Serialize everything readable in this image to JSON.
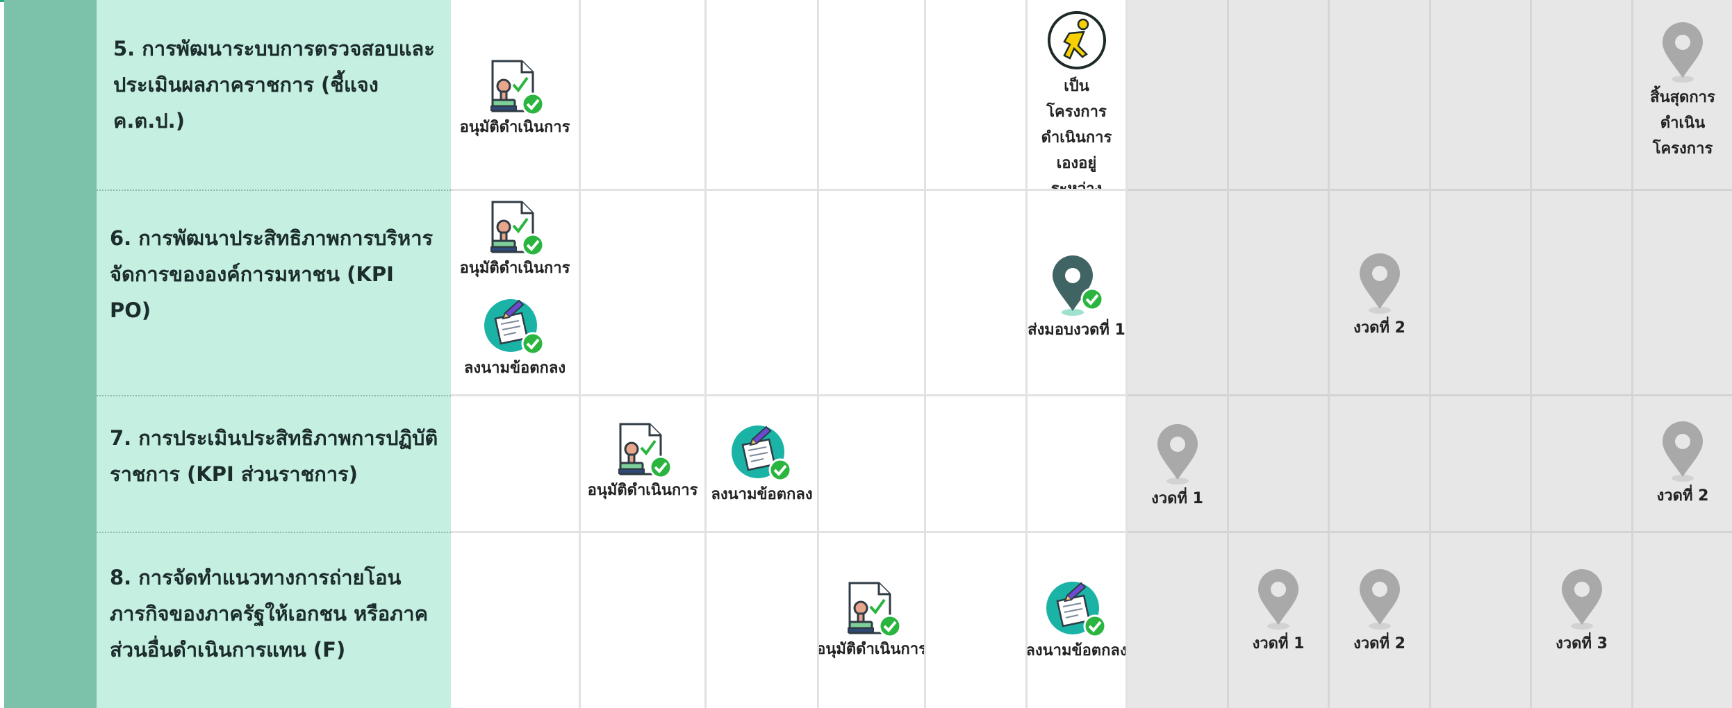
{
  "colors": {
    "accent_line": "#27a98a",
    "left_column": "#7cc2aa",
    "name_cell": "#c4efe1",
    "grey_cell": "#e7e7e7",
    "check_green": "#2ab53f",
    "pin_dark": "#3f6463",
    "pin_grey": "#a9a9a9",
    "sign_teal": "#1ab3a6",
    "aim_yellow": "#f6d000"
  },
  "rows": [
    {
      "name": "5. การพัฒนาระบบการตรวจสอบและประเมินผลภาคราชการ (ชี้แจง ค.ต.ป.)",
      "approve_label": "อนุมัติดำเนินการ",
      "running_label": "เป็นโครงการดำเนินการเองอยู่ระหว่างดำเนินการ",
      "end_label": "สิ้นสุดการดำเนินโครงการ"
    },
    {
      "name": "6. การพัฒนาประสิทธิภาพการบริหารจัดการขององค์การมหาชน (KPI PO)",
      "approve_label": "อนุมัติดำเนินการ",
      "sign_label": "ลงนามข้อตกลง",
      "deliver1_label": "ส่งมอบงวดที่ 1",
      "installment2_label": "งวดที่ 2"
    },
    {
      "name": "7. การประเมินประสิทธิภาพการปฏิบัติราชการ (KPI ส่วนราชการ)",
      "approve_label": "อนุมัติดำเนินการ",
      "sign_label": "ลงนามข้อตกลง",
      "installment1_label": "งวดที่ 1",
      "installment2_label": "งวดที่ 2"
    },
    {
      "name": "8. การจัดทำแนวทางการถ่ายโอนภารกิจของภาครัฐให้เอกชน หรือภาคส่วนอื่นดำเนินการแทน (F)",
      "approve_label": "อนุมัติดำเนินการ",
      "sign_label": "ลงนามข้อตกลง",
      "installment1_label": "งวดที่ 1",
      "installment2_label": "งวดที่ 2",
      "installment3_label": "งวดที่ 3"
    }
  ],
  "icons": {
    "approve": "approved-document-stamp-icon",
    "sign": "signed-agreement-icon",
    "running": "running-person-icon",
    "pin_done": "location-pin-done-icon",
    "pin_pending": "location-pin-pending-icon",
    "check": "check-badge-icon"
  }
}
